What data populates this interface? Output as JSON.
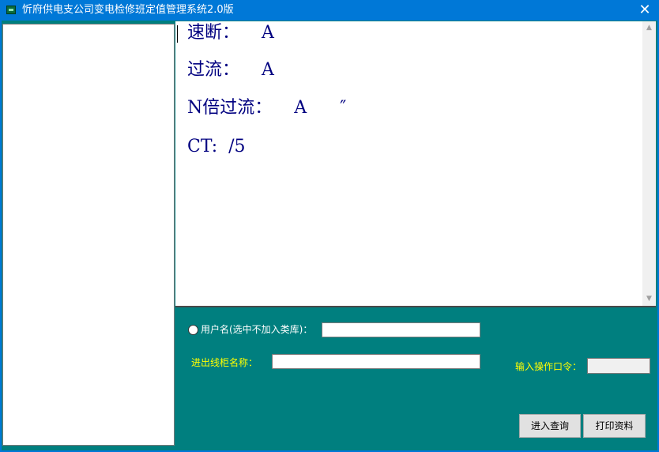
{
  "window": {
    "title": "忻府供电支公司变电检修班定值管理系统2.0版",
    "close_glyph": "✕"
  },
  "settings_text": {
    "line1": "速断：    A",
    "line2": "过流：    A",
    "line3": "N倍过流：    A      ″",
    "line4": "CT:  /5"
  },
  "form": {
    "username_label": "用户名(选中不加入类库)：",
    "username_value": "",
    "cabinet_label": "进出线柜名称：",
    "cabinet_value": "",
    "password_label": "输入操作口令：",
    "password_value": ""
  },
  "buttons": {
    "query": "进入查询",
    "print": "打印资料"
  },
  "scrollbar": {
    "up": "▲",
    "down": "▼"
  },
  "colors": {
    "title_bar": "#0078d7",
    "client_bg": "#007f7f",
    "settings_text": "#000080",
    "label_yellow": "#ffff00"
  }
}
